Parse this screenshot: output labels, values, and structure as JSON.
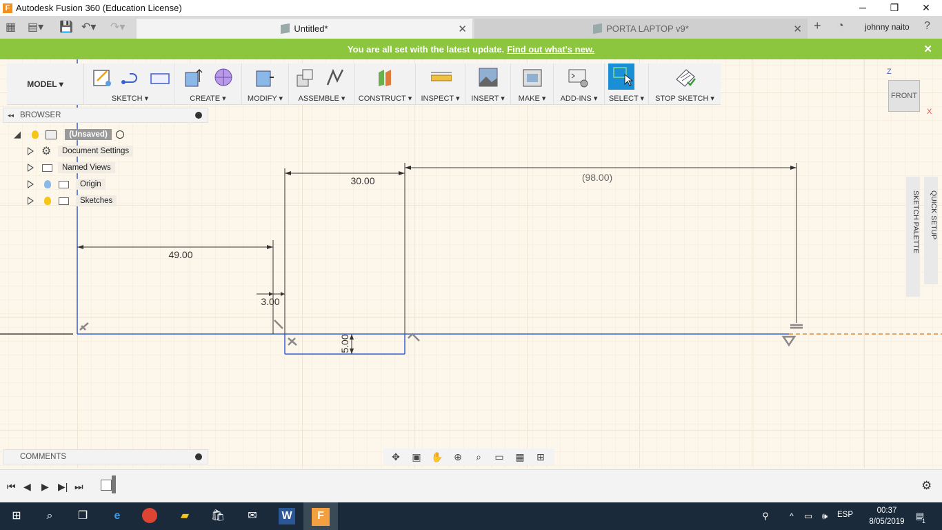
{
  "window": {
    "title": "Autodesk Fusion 360 (Education License)",
    "minimize": "─",
    "restore": "❐",
    "close": "✕"
  },
  "tabs": [
    {
      "label": "Untitled*",
      "close": "✕"
    },
    {
      "label": "PORTA LAPTOP v9*",
      "close": "✕"
    }
  ],
  "user": "johnny naito",
  "banner": {
    "text": "You are all set with the latest update.",
    "link": "Find out what's new.",
    "close": "✕"
  },
  "toolbar": {
    "workspace": "MODEL ▾",
    "groups": [
      "SKETCH ▾",
      "CREATE ▾",
      "MODIFY ▾",
      "ASSEMBLE ▾",
      "CONSTRUCT ▾",
      "INSPECT ▾",
      "INSERT ▾",
      "MAKE ▾",
      "ADD-INS ▾",
      "SELECT ▾",
      "STOP SKETCH ▾"
    ]
  },
  "browser": {
    "title": "BROWSER",
    "collapse": "◂◂",
    "root": "(Unsaved)",
    "items": [
      "Document Settings",
      "Named Views",
      "Origin",
      "Sketches"
    ]
  },
  "comments": {
    "title": "COMMENTS"
  },
  "sketch": {
    "dimensions": [
      "30.00",
      "(98.00)",
      "49.00",
      "3.00",
      "5.00"
    ]
  },
  "viewcube": {
    "face": "FRONT",
    "z": "Z",
    "x": "X"
  },
  "side_panels": [
    "SKETCH PALETTE",
    "QUICK SETUP"
  ],
  "taskbar": {
    "time": "00:37",
    "date": "8/05/2019",
    "lang": "ESP",
    "notifications": "1"
  },
  "colors": {
    "banner": "#8cc63e",
    "select_active": "#1a8fd6",
    "sketch_line": "#3a5fd0",
    "construction_line": "#e08a3a",
    "taskbar": "#1b2a3a"
  }
}
